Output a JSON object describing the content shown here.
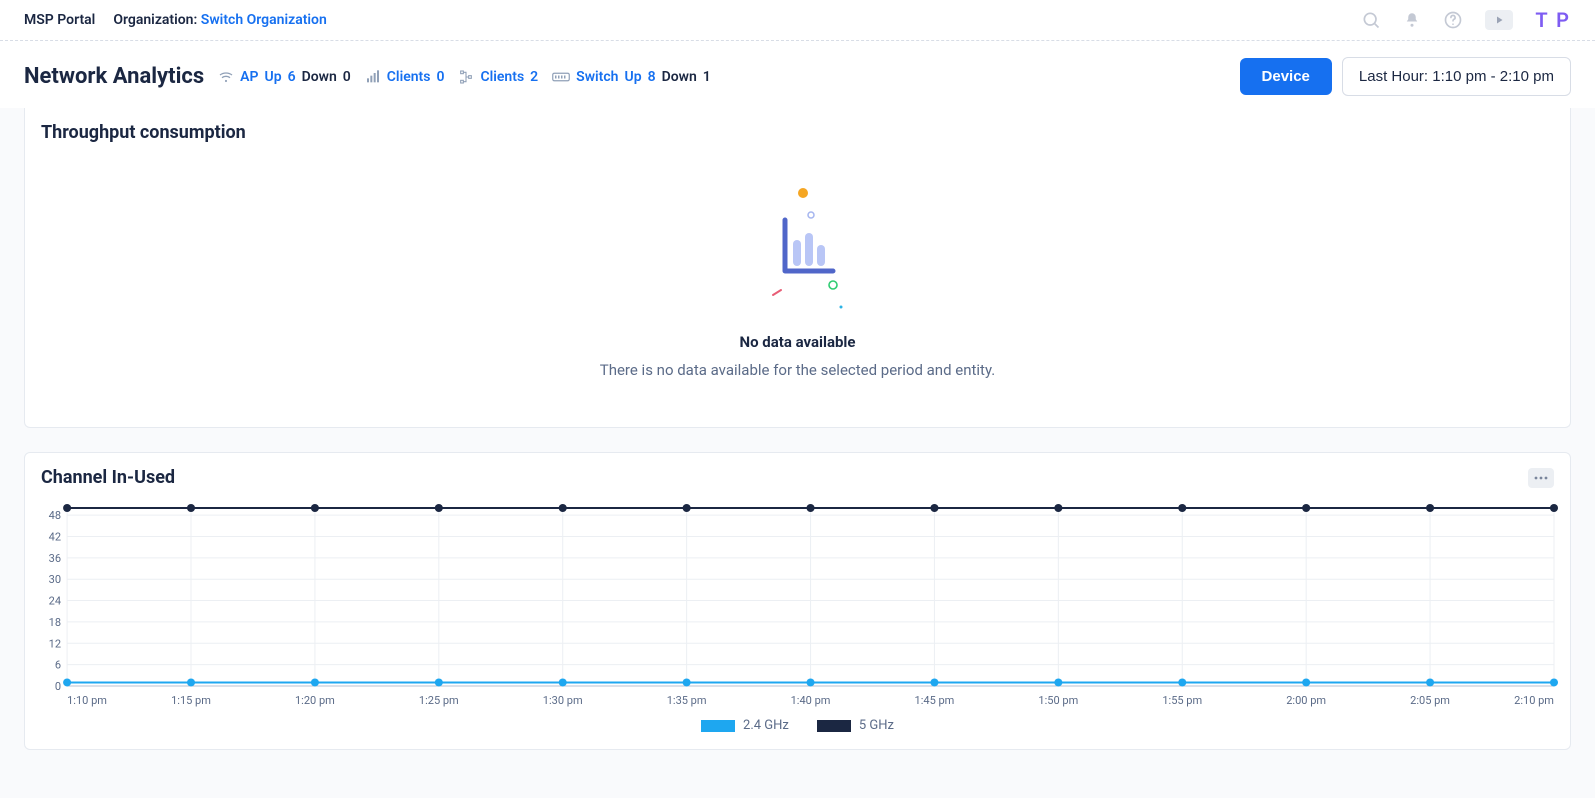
{
  "header": {
    "portal": "MSP Portal",
    "org_label": "Organization:",
    "switch_org": "Switch Organization",
    "avatar_initials": "T P"
  },
  "subheader": {
    "title": "Network Analytics",
    "stats": {
      "ap": {
        "label": "AP",
        "up_label": "Up",
        "up_value": "6",
        "down_label": "Down",
        "down_value": "0"
      },
      "clients1": {
        "label": "Clients",
        "value": "0"
      },
      "clients2": {
        "label": "Clients",
        "value": "2"
      },
      "switch": {
        "label": "Switch",
        "up_label": "Up",
        "up_value": "8",
        "down_label": "Down",
        "down_value": "1"
      }
    },
    "device_button": "Device",
    "time_range": "Last Hour: 1:10 pm - 2:10 pm"
  },
  "panel_throughput": {
    "title": "Throughput consumption",
    "empty_title": "No data available",
    "empty_sub": "There is no data available for the selected period and entity."
  },
  "panel_channel": {
    "title": "Channel In-Used",
    "legend": {
      "s1": "2.4 GHz",
      "s2": "5 GHz"
    }
  },
  "chart_data": {
    "type": "line",
    "title": "Channel In-Used",
    "xlabel": "",
    "ylabel": "",
    "ylim": [
      0,
      50
    ],
    "yticks": [
      0,
      6,
      12,
      18,
      24,
      30,
      36,
      42,
      48
    ],
    "categories": [
      "1:10 pm",
      "1:15 pm",
      "1:20 pm",
      "1:25 pm",
      "1:30 pm",
      "1:35 pm",
      "1:40 pm",
      "1:45 pm",
      "1:50 pm",
      "1:55 pm",
      "2:00 pm",
      "2:05 pm",
      "2:10 pm"
    ],
    "series": [
      {
        "name": "2.4 GHz",
        "values": [
          1,
          1,
          1,
          1,
          1,
          1,
          1,
          1,
          1,
          1,
          1,
          1,
          1
        ]
      },
      {
        "name": "5 GHz",
        "values": [
          50,
          50,
          50,
          50,
          50,
          50,
          50,
          50,
          50,
          50,
          50,
          50,
          50
        ]
      }
    ],
    "colors": {
      "2.4 GHz": "#1ea7f0",
      "5 GHz": "#1b2742"
    }
  }
}
